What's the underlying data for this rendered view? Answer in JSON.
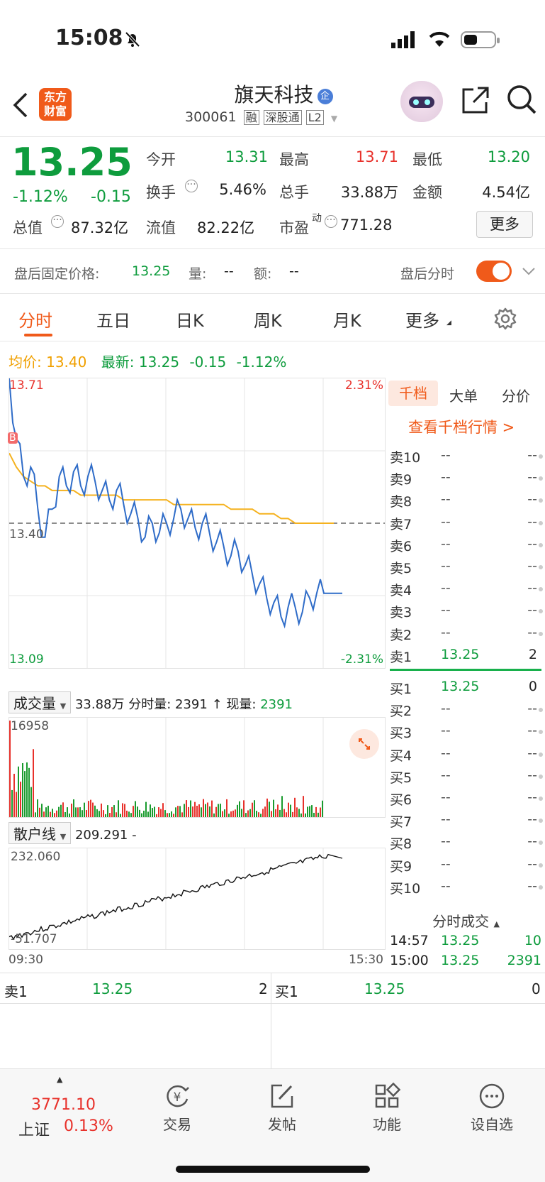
{
  "status_bar": {
    "time": "15:08"
  },
  "header": {
    "logo_line1": "东方",
    "logo_line2": "财富",
    "stock_name": "旗天科技",
    "badge_qi": "企",
    "code": "300061",
    "tags": [
      "融",
      "深股通",
      "L2"
    ]
  },
  "quote": {
    "price": "13.25",
    "change_pct": "-1.12%",
    "change": "-0.15",
    "fields": [
      {
        "label": "今开",
        "value": "13.31",
        "color": "green"
      },
      {
        "label": "最高",
        "value": "13.71",
        "color": "red"
      },
      {
        "label": "最低",
        "value": "13.20",
        "color": "green"
      },
      {
        "label": "换手",
        "value": "5.46%",
        "color": "black"
      },
      {
        "label": "总手",
        "value": "33.88万",
        "color": "black"
      },
      {
        "label": "金额",
        "value": "4.54亿",
        "color": "black"
      }
    ],
    "total_value_label": "总值",
    "total_value": "87.32亿",
    "float_value_label": "流值",
    "float_value": "82.22亿",
    "pe_label": "市盈",
    "pe_sup": "动",
    "pe_value": "771.28",
    "more_button": "更多"
  },
  "after_hours": {
    "label": "盘后固定价格:",
    "price": "13.25",
    "vol_label": "量:",
    "vol": "--",
    "amt_label": "额:",
    "amt": "--",
    "toggle_label": "盘后分时"
  },
  "tabs": [
    "分时",
    "五日",
    "日K",
    "周K",
    "月K",
    "更多"
  ],
  "avg_line": {
    "avg_label": "均价:",
    "avg_value": "13.40",
    "latest_label": "最新:",
    "latest_value": "13.25",
    "change": "-0.15",
    "change_pct": "-1.12%"
  },
  "chart_labels": {
    "top_price": "13.71",
    "top_pct": "2.31%",
    "mid_price": "13.40",
    "bottom_price": "13.09",
    "bottom_pct": "-2.31%",
    "b_marker": "B",
    "time_start": "09:30",
    "time_end": "15:30"
  },
  "volume_bar": {
    "selector": "成交量",
    "total": "33.88万",
    "fsl_label": "分时量:",
    "fsl_value": "2391",
    "arrow": "↑",
    "now_label": "现量:",
    "now_value": "2391",
    "max_label": "16958"
  },
  "retail_bar": {
    "selector": "散户线",
    "value": "209.291 -",
    "top": "232.060",
    "bottom": "-51.707"
  },
  "chart_data": {
    "type": "line",
    "title": "",
    "x_range": [
      "09:30",
      "15:30"
    ],
    "ylim": [
      13.09,
      13.71
    ],
    "prev_close": 13.4,
    "series": [
      {
        "name": "最新",
        "color": "#2f6cc8",
        "values": [
          13.71,
          13.58,
          13.5,
          13.52,
          13.43,
          13.37,
          13.43,
          13.5,
          13.48,
          13.51,
          13.48,
          13.5,
          13.49,
          13.47,
          13.45,
          13.47,
          13.44,
          13.42,
          13.41,
          13.37,
          13.4,
          13.38,
          13.4,
          13.41,
          13.43,
          13.41,
          13.39,
          13.4,
          13.38,
          13.36,
          13.35,
          13.33,
          13.34,
          13.31,
          13.29,
          13.27,
          13.24,
          13.23,
          13.2,
          13.22,
          13.22,
          13.21,
          13.24,
          13.25,
          13.25
        ]
      },
      {
        "name": "均价",
        "color": "#f5b21f",
        "values": [
          13.55,
          13.52,
          13.5,
          13.49,
          13.48,
          13.48,
          13.47,
          13.47,
          13.47,
          13.47,
          13.46,
          13.46,
          13.46,
          13.46,
          13.46,
          13.46,
          13.45,
          13.45,
          13.45,
          13.45,
          13.45,
          13.45,
          13.45,
          13.44,
          13.44,
          13.44,
          13.44,
          13.44,
          13.44,
          13.44,
          13.44,
          13.43,
          13.43,
          13.43,
          13.43,
          13.42,
          13.42,
          13.42,
          13.41,
          13.41,
          13.4,
          13.4,
          13.4,
          13.4,
          13.4
        ]
      }
    ],
    "volume_max": 16958,
    "retail_range": [
      -51.707,
      232.06
    ]
  },
  "side_panel": {
    "tabs": [
      "千档",
      "大单",
      "分价"
    ],
    "link": "查看千档行情 >",
    "sell": [
      {
        "label": "卖10",
        "price": "--",
        "vol": "--"
      },
      {
        "label": "卖9",
        "price": "--",
        "vol": "--"
      },
      {
        "label": "卖8",
        "price": "--",
        "vol": "--"
      },
      {
        "label": "卖7",
        "price": "--",
        "vol": "--"
      },
      {
        "label": "卖6",
        "price": "--",
        "vol": "--"
      },
      {
        "label": "卖5",
        "price": "--",
        "vol": "--"
      },
      {
        "label": "卖4",
        "price": "--",
        "vol": "--"
      },
      {
        "label": "卖3",
        "price": "--",
        "vol": "--"
      },
      {
        "label": "卖2",
        "price": "--",
        "vol": "--"
      },
      {
        "label": "卖1",
        "price": "13.25",
        "vol": "2"
      }
    ],
    "buy": [
      {
        "label": "买1",
        "price": "13.25",
        "vol": "0"
      },
      {
        "label": "买2",
        "price": "--",
        "vol": "--"
      },
      {
        "label": "买3",
        "price": "--",
        "vol": "--"
      },
      {
        "label": "买4",
        "price": "--",
        "vol": "--"
      },
      {
        "label": "买5",
        "price": "--",
        "vol": "--"
      },
      {
        "label": "买6",
        "price": "--",
        "vol": "--"
      },
      {
        "label": "买7",
        "price": "--",
        "vol": "--"
      },
      {
        "label": "买8",
        "price": "--",
        "vol": "--"
      },
      {
        "label": "买9",
        "price": "--",
        "vol": "--"
      },
      {
        "label": "买10",
        "price": "--",
        "vol": "--"
      }
    ],
    "trades_title": "分时成交",
    "trades": [
      {
        "time": "14:57",
        "price": "13.25",
        "vol": "10"
      },
      {
        "time": "15:00",
        "price": "13.25",
        "vol": "2391"
      }
    ]
  },
  "bottom_quote": {
    "sell_label": "卖1",
    "sell_price": "13.25",
    "sell_vol": "2",
    "buy_label": "买1",
    "buy_price": "13.25",
    "buy_vol": "0"
  },
  "bottom_nav": {
    "index_value": "3771.10",
    "index_name": "上证",
    "index_pct": "0.13%",
    "items": [
      "交易",
      "发帖",
      "功能",
      "设自选"
    ]
  },
  "colors": {
    "up": "#e8312b",
    "down": "#0e9c3d",
    "accent": "#f05a1a"
  }
}
